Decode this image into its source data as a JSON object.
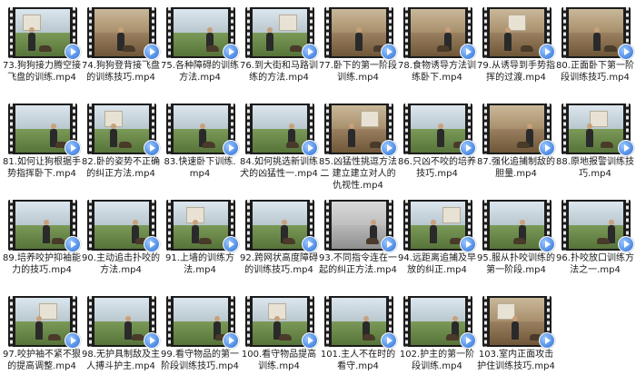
{
  "files": [
    {
      "name": "73.狗狗接力腾空接飞盘的训练.mp4"
    },
    {
      "name": "74.狗狗登背接飞盘的训练技巧.mp4"
    },
    {
      "name": "75.各种障碍的训练方法.mp4"
    },
    {
      "name": "76.到大街和马路训练的方法.mp4"
    },
    {
      "name": "77.卧下的第一阶段训练.mp4"
    },
    {
      "name": "78.食物诱导方法训练卧下.mp4"
    },
    {
      "name": "79.从诱导到手势指挥的过渡.mp4"
    },
    {
      "name": "80.正面卧下第一阶段训练技巧.mp4"
    },
    {
      "name": "81.如何让狗根据手势指挥卧下.mp4"
    },
    {
      "name": "82.卧的姿势不正确的纠正方法.mp4"
    },
    {
      "name": "83.快速卧下训练.mp4"
    },
    {
      "name": "84.如何挑选新训练犬的凶猛性一.mp4"
    },
    {
      "name": "85.凶猛性挑逗方法二 建立建立对人的仇视性.mp4"
    },
    {
      "name": "86.只凶不咬的培养技巧.mp4"
    },
    {
      "name": "87.强化追捕制敌的胆量.mp4"
    },
    {
      "name": "88.原地报警训练技巧.mp4"
    },
    {
      "name": "89.培养咬护抑袖能力的技巧.mp4"
    },
    {
      "name": "90.主动追击扑咬的方法.mp4"
    },
    {
      "name": "91.上墙的训练方法.mp4"
    },
    {
      "name": "92.跨网状高度障碍的训练技巧.mp4"
    },
    {
      "name": "93.不同指令连在一起的纠正方法.mp4"
    },
    {
      "name": "94.远距离追捕及早放的纠正.mp4"
    },
    {
      "name": "95.服从扑咬训练的第一阶段.mp4"
    },
    {
      "name": "96.扑咬放口训练方法之一.mp4"
    },
    {
      "name": "97.咬护袖不紧不狠的提高调整.mp4"
    },
    {
      "name": "98.无护具制敌及主人搏斗护主.mp4"
    },
    {
      "name": "99.看守物品的第一阶段训练技巧.mp4"
    },
    {
      "name": "100.看守物品提高训练.mp4"
    },
    {
      "name": "101.主人不在时的看守.mp4"
    },
    {
      "name": "102.护主的第一阶段训练.mp4"
    },
    {
      "name": "103.室内正面攻击护住训练技巧.mp4"
    }
  ],
  "icons": {
    "play": "play-badge-icon",
    "film": "film-strip-icon"
  },
  "colors": {
    "accent": "#2a6fd6",
    "text": "#1a1a1a",
    "background": "#ffffff"
  }
}
